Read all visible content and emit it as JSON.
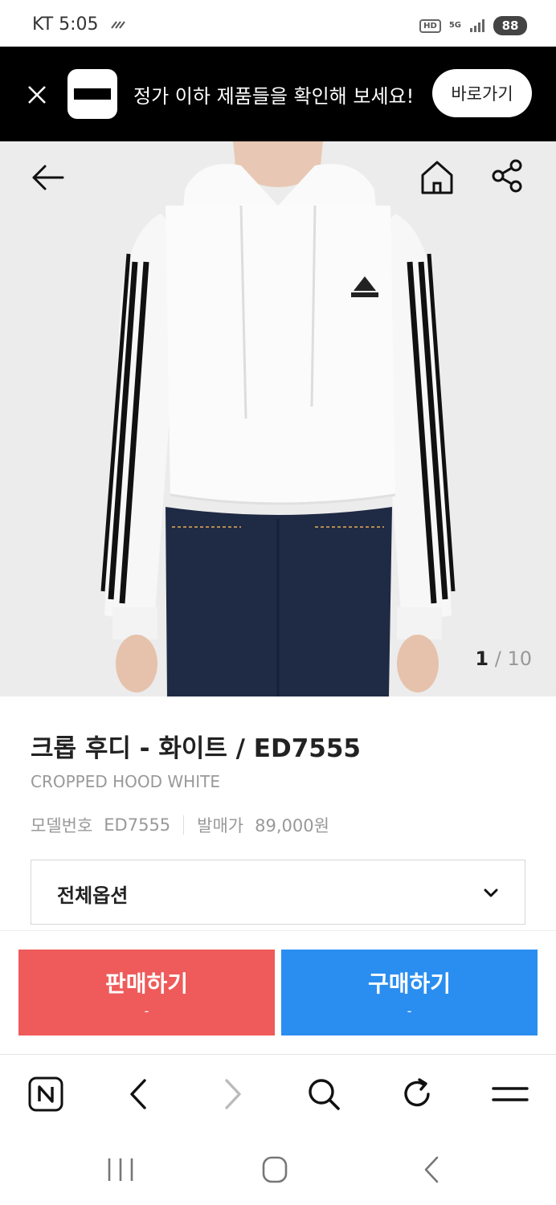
{
  "status_bar": {
    "carrier_time": "KT 5:05",
    "hd": "HD",
    "network": "5G",
    "battery": "88"
  },
  "banner": {
    "text": "정가 이하 제품들을 확인해 보세요!",
    "button_label": "바로가기"
  },
  "gallery": {
    "current": "1",
    "separator": " / ",
    "total": "10"
  },
  "product": {
    "name_ko": "크롭 후디 - 화이트 / ED7555",
    "name_en": "CROPPED HOOD WHITE",
    "model_label": "모델번호",
    "model_value": "ED7555",
    "price_label": "발매가",
    "price_value": "89,000원"
  },
  "options": {
    "selected": "전체옵션"
  },
  "trade": {
    "sell_label": "판매하기",
    "sell_price": "-",
    "buy_label": "구매하기",
    "buy_price": "-",
    "sell_color": "#ef5a5a",
    "buy_color": "#2a8ef0"
  },
  "toolbar": {
    "icons": [
      "naver-icon",
      "back-icon",
      "forward-icon",
      "search-icon",
      "refresh-icon",
      "menu-icon"
    ]
  },
  "nav": {
    "icons": [
      "recents-icon",
      "home-icon",
      "back-icon"
    ]
  }
}
